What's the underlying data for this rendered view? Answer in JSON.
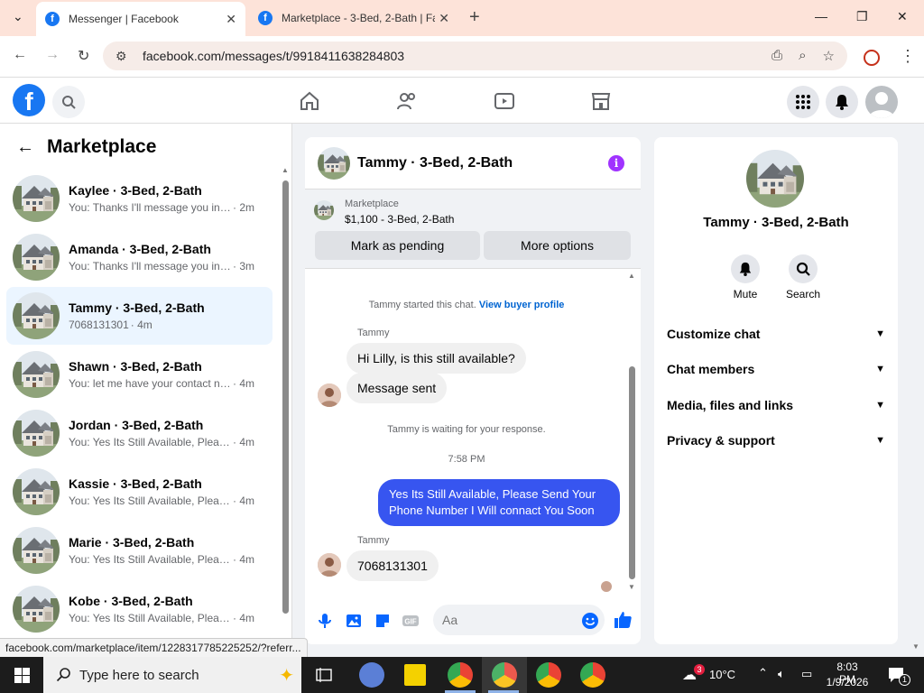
{
  "browser": {
    "tabs": [
      {
        "title": "Messenger | Facebook",
        "active": true
      },
      {
        "title": "Marketplace - 3-Bed, 2-Bath | Fa",
        "active": false
      }
    ],
    "url": "facebook.com/messages/t/9918411638284803",
    "status_url": "facebook.com/marketplace/item/1228317785225252/?referr..."
  },
  "left": {
    "title": "Marketplace",
    "conversations": [
      {
        "name": "Kaylee · 3-Bed, 2-Bath",
        "preview": "You: Thanks I'll message you in a ...",
        "time": "· 2m",
        "active": false
      },
      {
        "name": "Amanda · 3-Bed, 2-Bath",
        "preview": "You: Thanks I'll message you in a ...",
        "time": "· 3m",
        "active": false
      },
      {
        "name": "Tammy · 3-Bed, 2-Bath",
        "preview": "7068131301",
        "time": "· 4m",
        "active": true
      },
      {
        "name": "Shawn · 3-Bed, 2-Bath",
        "preview": "You: let me have your contact nu...",
        "time": "· 4m",
        "active": false
      },
      {
        "name": "Jordan · 3-Bed, 2-Bath",
        "preview": "You: Yes Its Still Available, Please S...",
        "time": "· 4m",
        "active": false
      },
      {
        "name": "Kassie · 3-Bed, 2-Bath",
        "preview": "You: Yes Its Still Available, Please S...",
        "time": "· 4m",
        "active": false
      },
      {
        "name": "Marie · 3-Bed, 2-Bath",
        "preview": "You: Yes Its Still Available, Please S...",
        "time": "· 4m",
        "active": false
      },
      {
        "name": "Kobe · 3-Bed, 2-Bath",
        "preview": "You: Yes Its Still Available, Please S...",
        "time": "· 4m",
        "active": false
      }
    ]
  },
  "chat": {
    "title": "Tammy · 3-Bed, 2-Bath",
    "listing_label": "Marketplace",
    "listing_price": "$1,100 - 3-Bed, 2-Bath",
    "btn_pending": "Mark as pending",
    "btn_more": "More options",
    "started_text": "Tammy started this chat.",
    "buyer_profile_link": "View buyer profile",
    "sender_name": "Tammy",
    "msg1": "Hi Lilly, is this still available?",
    "msg2": "Message sent",
    "waiting_text": "Tammy is waiting for your response.",
    "timestamp": "7:58 PM",
    "msg_out": "Yes Its Still Available, Please Send Your Phone Number I Will connact You Soon",
    "msg3": "7068131301",
    "composer_placeholder": "Aa"
  },
  "right": {
    "name": "Tammy · 3-Bed, 2-Bath",
    "mute_label": "Mute",
    "search_label": "Search",
    "sections": [
      "Customize chat",
      "Chat members",
      "Media, files and links",
      "Privacy & support"
    ]
  },
  "taskbar": {
    "search_placeholder": "Type here to search",
    "weather": "10°C",
    "time": "8:03 PM",
    "date": "1/9/2026",
    "chrome_badge": "3",
    "notif_count": "1"
  },
  "colors": {
    "fb_blue": "#1877f2",
    "outgoing_bubble": "#3755f0",
    "active_conv": "#ebf5ff",
    "info_purple": "#a033ff"
  }
}
